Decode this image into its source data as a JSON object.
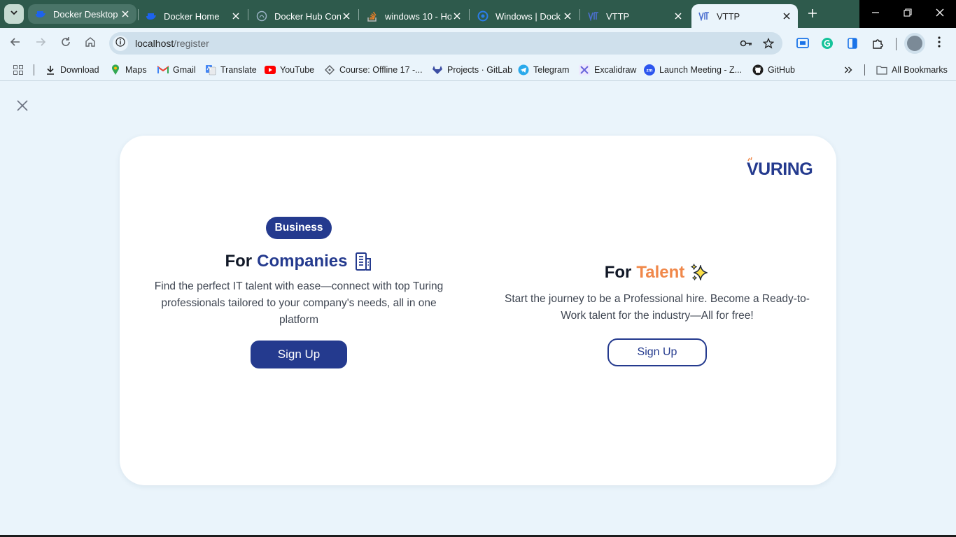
{
  "browser": {
    "tabs": [
      {
        "title": "Docker Desktop",
        "favicon": "docker-icon",
        "state": "hover"
      },
      {
        "title": "Docker Home",
        "favicon": "docker-icon",
        "state": "normal"
      },
      {
        "title": "Docker Hub Con",
        "favicon": "globe-icon",
        "state": "normal"
      },
      {
        "title": "windows 10 - Ho",
        "favicon": "stackoverflow-icon",
        "state": "normal"
      },
      {
        "title": "Windows | Dock",
        "favicon": "globe-icon",
        "state": "normal"
      },
      {
        "title": "VTTP",
        "favicon": "vttp-logo-icon",
        "state": "normal"
      },
      {
        "title": "VTTP",
        "favicon": "vttp-logo-icon",
        "state": "active"
      }
    ],
    "address": {
      "host": "localhost",
      "path": "/register"
    },
    "bookmarks": [
      {
        "label": "Download",
        "icon": "download-icon"
      },
      {
        "label": "Maps",
        "icon": "maps-icon"
      },
      {
        "label": "Gmail",
        "icon": "gmail-icon"
      },
      {
        "label": "Translate",
        "icon": "translate-icon"
      },
      {
        "label": "YouTube",
        "icon": "youtube-icon"
      },
      {
        "label": "Course: Offline 17 -...",
        "icon": "course-icon"
      },
      {
        "label": "Projects · GitLab",
        "icon": "gitlab-icon"
      },
      {
        "label": "Telegram",
        "icon": "telegram-icon"
      },
      {
        "label": "Excalidraw",
        "icon": "excalidraw-icon"
      },
      {
        "label": "Launch Meeting - Z...",
        "icon": "zoom-icon"
      },
      {
        "label": "GitHub",
        "icon": "github-icon"
      }
    ],
    "all_bookmarks": "All Bookmarks"
  },
  "page": {
    "logo_text": "VURING",
    "business": {
      "badge": "Business",
      "heading_prefix": "For",
      "heading_accent": "Companies",
      "description": "Find the perfect IT talent with ease—connect with top Turing professionals tailored to your company's needs, all in one platform",
      "button": "Sign Up"
    },
    "talent": {
      "heading_prefix": "For",
      "heading_accent": "Talent",
      "description": "Start the journey to be a Professional hire. Become a Ready-to-Work talent for the industry—All for free!",
      "button": "Sign Up"
    }
  },
  "colors": {
    "brand_blue": "#243a8e",
    "accent_orange": "#f0884a",
    "page_bg": "#eaf4fb",
    "tabstrip_bg": "#2e5a4c"
  }
}
